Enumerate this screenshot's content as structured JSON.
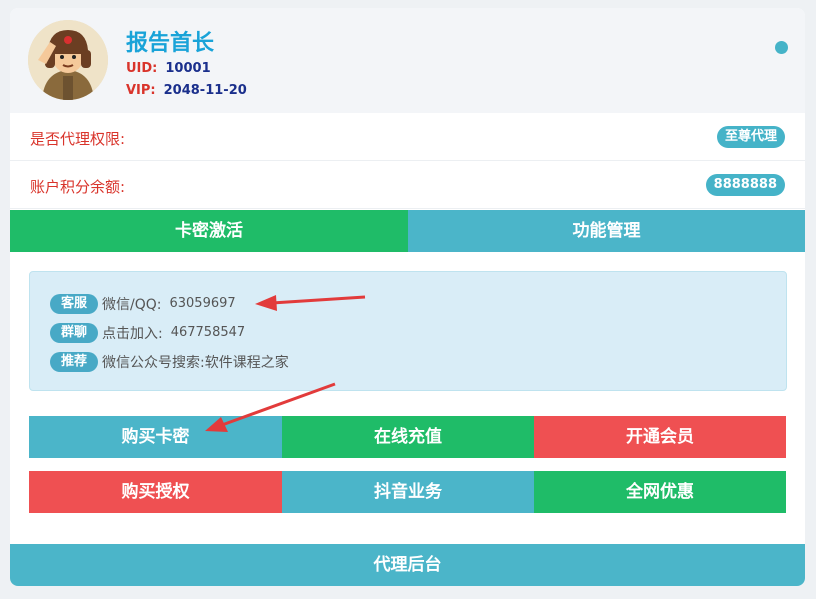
{
  "profile": {
    "name": "报告首长",
    "uid_label": "UID:",
    "uid_value": "10001",
    "vip_label": "VIP:",
    "vip_value": "2048-11-20"
  },
  "info": {
    "agent_label": "是否代理权限:",
    "agent_value": "至尊代理",
    "points_label": "账户积分余额:",
    "points_value": "8888888"
  },
  "tabs": [
    {
      "label": "卡密激活",
      "active": true
    },
    {
      "label": "功能管理",
      "active": false
    }
  ],
  "notice": {
    "service_badge": "客服",
    "service_text": "微信/QQ:",
    "service_value": "63059697",
    "group_badge": "群聊",
    "group_text": "点击加入:",
    "group_value": "467758547",
    "recommend_badge": "推荐",
    "recommend_text": "微信公众号搜索:软件课程之家"
  },
  "buttons_row1": [
    "购买卡密",
    "在线充值",
    "开通会员"
  ],
  "buttons_row2": [
    "购买授权",
    "抖音业务",
    "全网优惠"
  ],
  "footer": {
    "proxy_label": "代理后台"
  },
  "colors": {
    "teal": "#4bb5c9",
    "green": "#1fbc68",
    "red": "#ef5052",
    "name_blue": "#19a3d8",
    "label_red": "#d9342b",
    "annotation_red": "#e23b3b"
  }
}
